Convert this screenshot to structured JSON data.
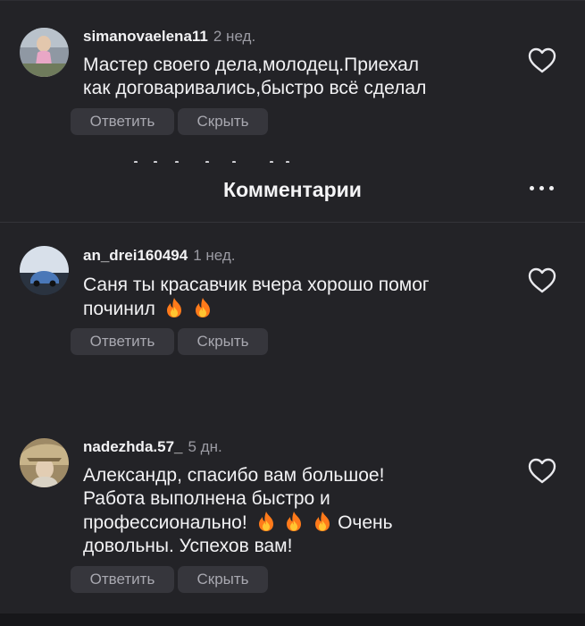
{
  "header": {
    "title": "Комментарии",
    "more_icon": "more-horizontal-icon"
  },
  "comments": [
    {
      "username": "simanovaelena11",
      "time": "2 нед.",
      "lines": [
        "Мастер своего дела,молодец.Приехал",
        "как договаривались,быстро всё сделал"
      ],
      "reply_label": "Ответить",
      "hide_label": "Скрыть"
    },
    {
      "username": "an_drei160494",
      "time": "1 нед.",
      "lines": [
        "Саня ты красавчик вчера хорошо помог",
        "починил"
      ],
      "reply_label": "Ответить",
      "hide_label": "Скрыть"
    },
    {
      "username": "nadezhda.57_",
      "time": "5 дн.",
      "lines": [
        "Александр, спасибо вам большое!",
        "Работа выполнена быстро и",
        "профессионально!",
        "Очень",
        "довольны. Успехов вам!"
      ],
      "reply_label": "Ответить",
      "hide_label": "Скрыть"
    }
  ],
  "colors": {
    "background": "#232327",
    "button_bg": "#36363c",
    "secondary_text": "#9b9ba3",
    "fire": "#ff7a1a"
  }
}
